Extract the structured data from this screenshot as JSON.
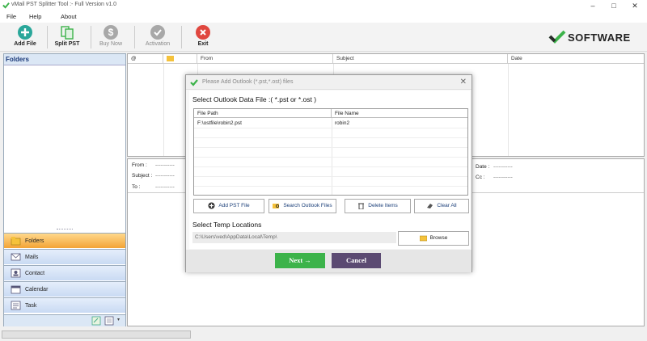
{
  "window": {
    "title": "vMail PST Splitter Tool :- Full Version v1.0",
    "minimize": "–",
    "maximize": "□",
    "close": "✕"
  },
  "menu": [
    "File",
    "Help",
    "About"
  ],
  "toolbar": {
    "add_file": "Add File",
    "split_pst": "Split PST",
    "buy_now": "Buy Now",
    "activation": "Activation",
    "exit": "Exit"
  },
  "brand": "SOFTWARE",
  "left_panel": {
    "title": "Folders",
    "nav": [
      "Folders",
      "Mails",
      "Contact",
      "Calendar",
      "Task"
    ]
  },
  "mail_list": {
    "columns": [
      "From",
      "Subject",
      "Date"
    ]
  },
  "preview": {
    "from_label": "From :",
    "subject_label": "Subject :",
    "to_label": "To :",
    "date_label": "Date :",
    "cc_label": "Cc :",
    "placeholder": "-----------"
  },
  "dialog": {
    "title": "Please Add Outlook (*.pst,*.ost) files",
    "close": "✕",
    "heading": "Select Outlook Data File :( *.pst or *.ost )",
    "table": {
      "columns": [
        "File Path",
        "File Name"
      ],
      "rows": [
        {
          "path": "F:\\ostfile\\robin2.pst",
          "name": "robin2"
        }
      ]
    },
    "buttons": {
      "add": "Add PST File",
      "search": "Search Outlook Files",
      "delete": "Delete Items",
      "clear": "Clear All"
    },
    "temp_heading": "Select Temp Locations",
    "temp_path": "C:\\Users\\ved\\AppData\\Local\\Temp\\",
    "browse": "Browse",
    "next": "Next  →",
    "cancel": "Cancel"
  },
  "colors": {
    "accent_green": "#3cb34a",
    "cancel_purple": "#5b4a72",
    "exit_red": "#e0473f",
    "add_file_teal": "#2aa79a",
    "nav_active": "#f3a436"
  }
}
